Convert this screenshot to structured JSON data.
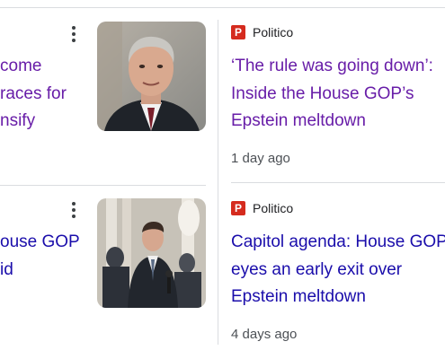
{
  "colors": {
    "visited_link": "#681da8",
    "unvisited_link": "#1a0dab",
    "divider": "#dadce0",
    "politico_brand": "#d52b1e"
  },
  "left_column": {
    "cards": [
      {
        "headline_lines": [
          "come",
          "races for",
          "nsify"
        ],
        "thumbnail": "man-speaking-portrait",
        "menu_icon": "more-vert-icon"
      },
      {
        "headline_lines": [
          "ouse GOP",
          "id"
        ],
        "thumbnail": "man-speaking-to-press-in-capitol",
        "menu_icon": "more-vert-icon"
      }
    ]
  },
  "right_column": {
    "cards": [
      {
        "source": {
          "logo_letter": "P",
          "name": "Politico",
          "icon": "politico-logo"
        },
        "headline_lines": [
          "‘The rule was going down’:",
          "Inside the House GOP’s",
          "Epstein meltdown"
        ],
        "time": "1 day ago",
        "visited": true
      },
      {
        "source": {
          "logo_letter": "P",
          "name": "Politico",
          "icon": "politico-logo"
        },
        "headline_lines": [
          "Capitol agenda: House GOP",
          "eyes an early exit over",
          "Epstein meltdown"
        ],
        "time": "4 days ago",
        "visited": false
      }
    ]
  }
}
